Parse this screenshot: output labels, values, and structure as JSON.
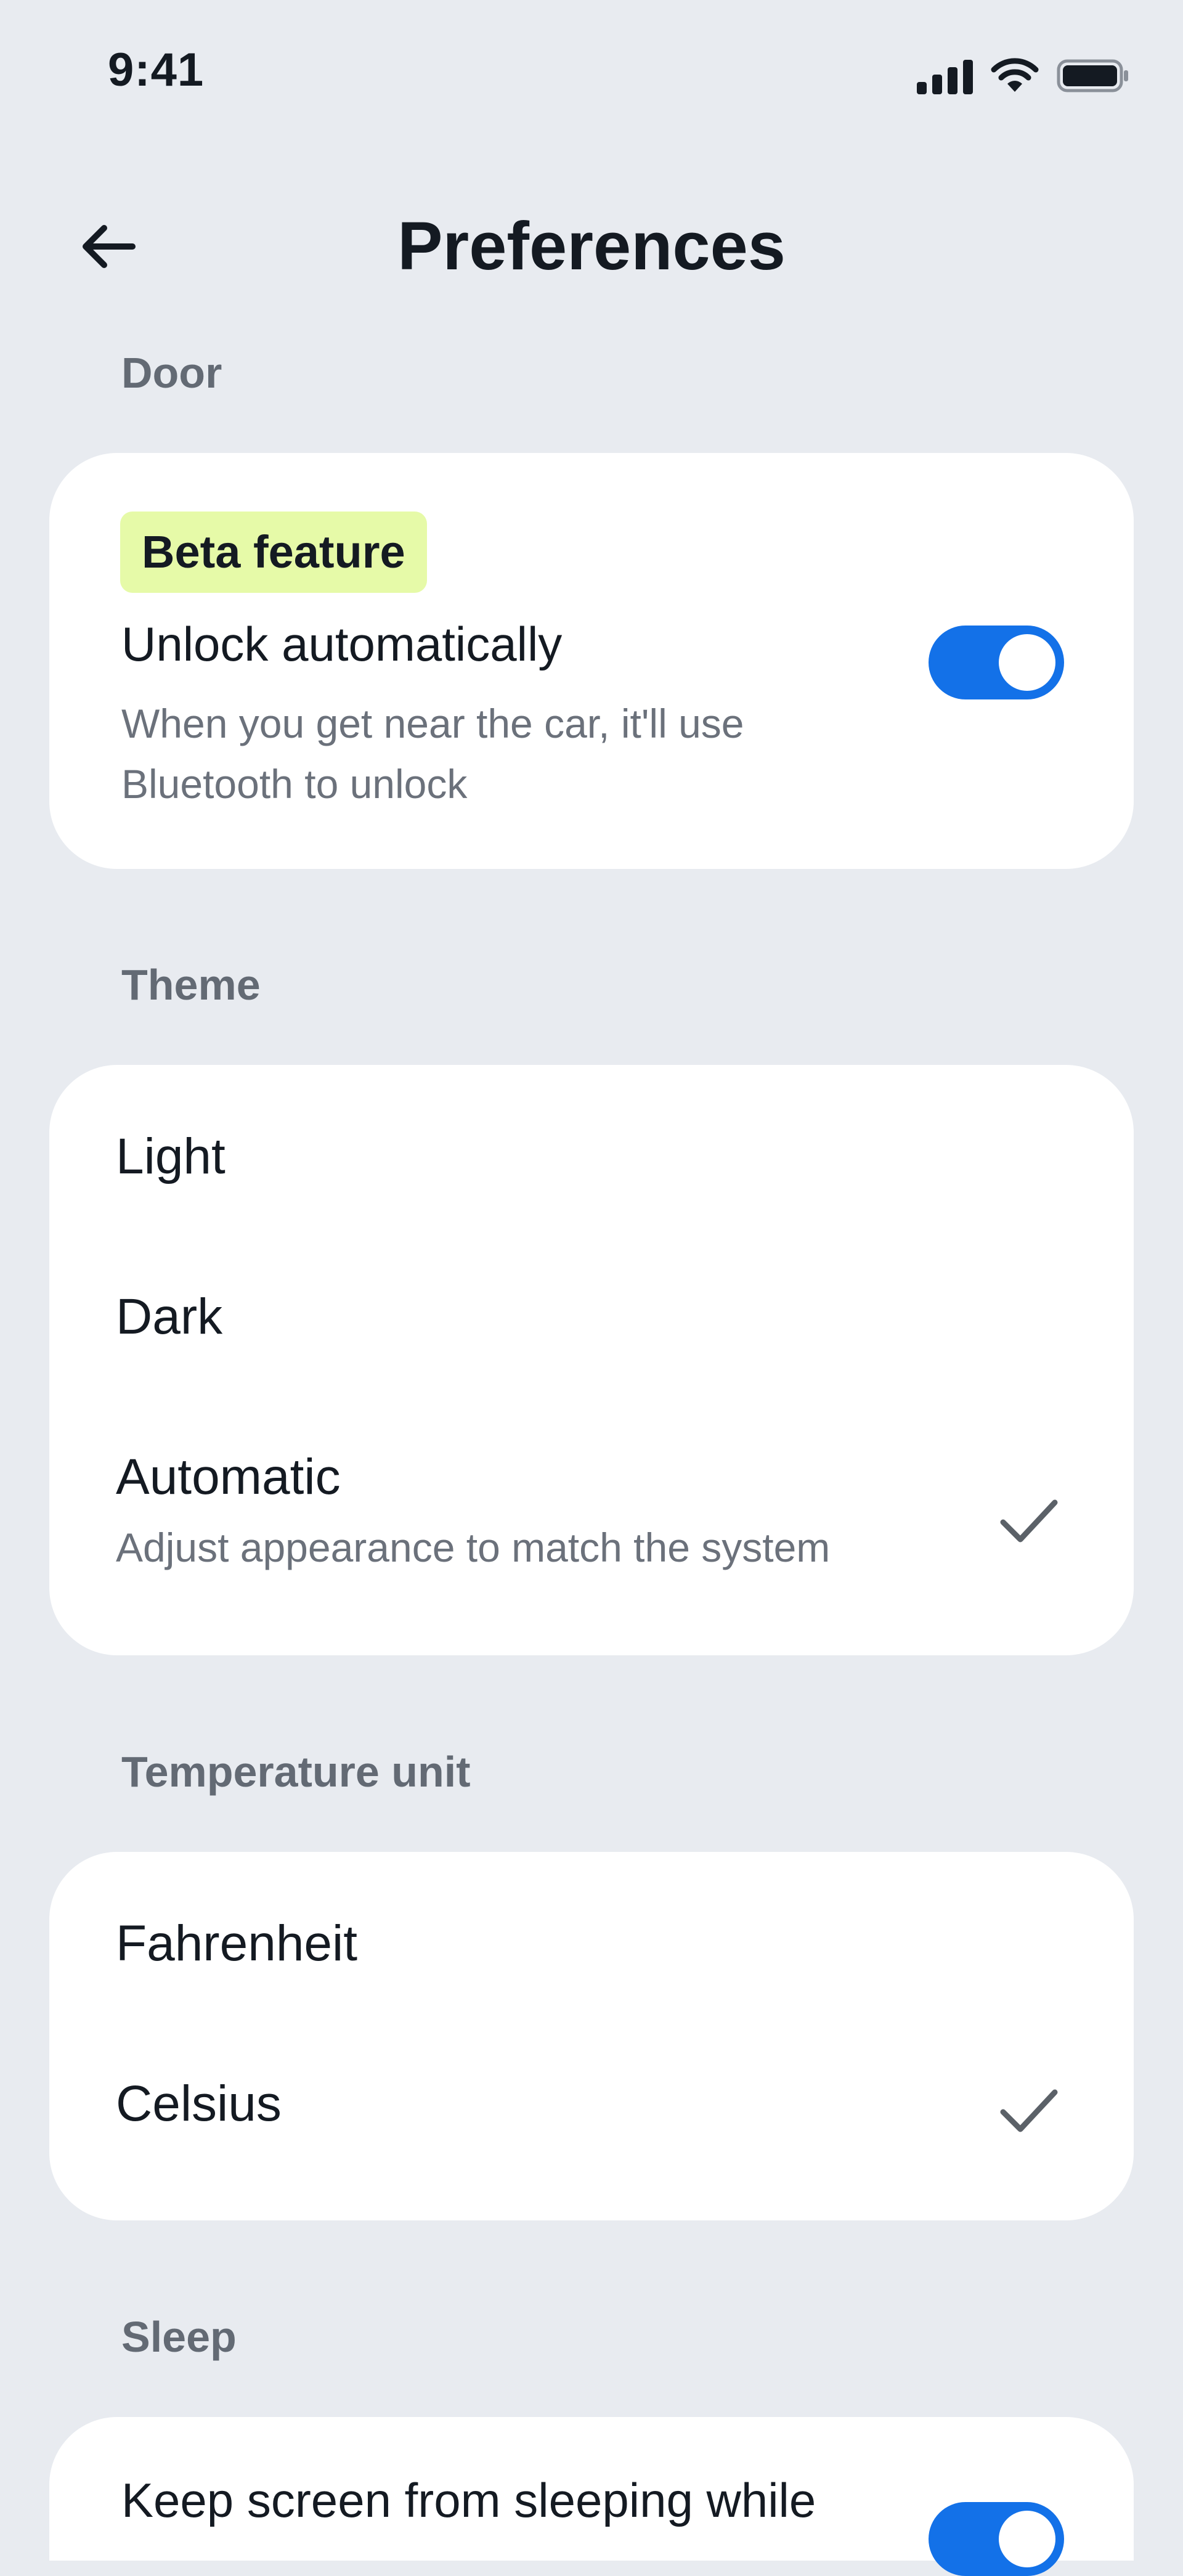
{
  "status_bar": {
    "time": "9:41",
    "icons": [
      "signal-icon",
      "wifi-icon",
      "battery-icon"
    ]
  },
  "header": {
    "back_icon": "arrow-left-icon",
    "title": "Preferences"
  },
  "sections": {
    "door": {
      "label": "Door",
      "badge": "Beta feature",
      "setting_title": "Unlock automatically",
      "setting_desc_line1": "When you get near the car, it'll use",
      "setting_desc_line2": "Bluetooth to unlock",
      "toggle_on": true
    },
    "theme": {
      "label": "Theme",
      "options": [
        {
          "label": "Light",
          "selected": false
        },
        {
          "label": "Dark",
          "selected": false
        },
        {
          "label": "Automatic",
          "sublabel": "Adjust appearance to match the system",
          "selected": true
        }
      ]
    },
    "temperature": {
      "label": "Temperature unit",
      "options": [
        {
          "label": "Fahrenheit",
          "selected": false
        },
        {
          "label": "Celsius",
          "selected": true
        }
      ]
    },
    "sleep": {
      "label": "Sleep",
      "setting_title": "Keep screen from sleeping while",
      "toggle_on": true
    }
  },
  "colors": {
    "background": "#E8EBF0",
    "card": "#FFFFFF",
    "accent": "#1371E8",
    "badge": "#E6FAA8",
    "text": "#141A22",
    "muted": "#6B717B"
  }
}
